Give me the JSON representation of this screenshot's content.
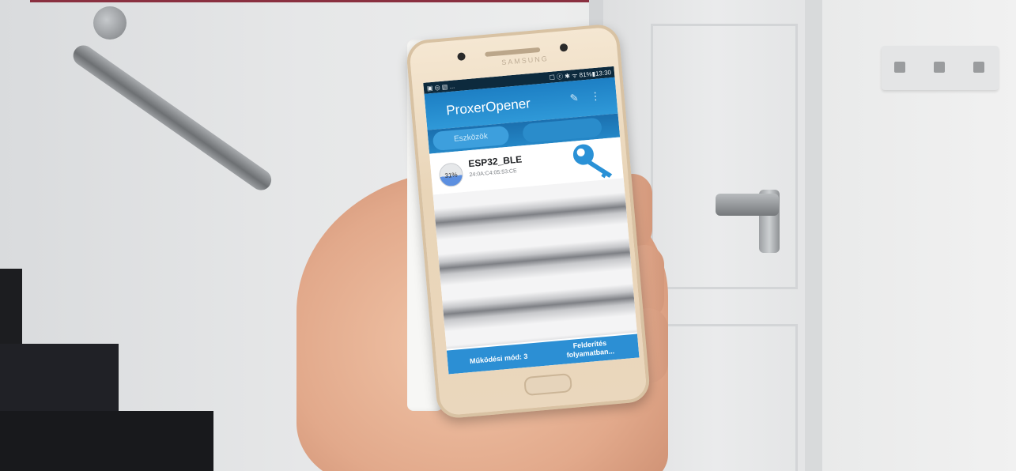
{
  "scene": {
    "phone_brand": "SAMSUNG"
  },
  "phone_screen": {
    "statusbar": {
      "left_icons": "▣ ◎ ▤ ...",
      "right": "☐ ⓒ ✱ ᯤ 81%▮13:30"
    },
    "appbar": {
      "title": "ProxerOpener",
      "tool_icon": "✎",
      "more_icon": "⋮"
    },
    "tabs": {
      "active_label": "Eszközök",
      "second_label": ""
    },
    "device": {
      "battery_label": "31%",
      "name": "ESP32_BLE",
      "mac": "24:0A:C4:05:53:CE",
      "icon": "key-icon"
    },
    "footer": {
      "mode_label": "Működési mód: 3",
      "scan_line1": "Felderítés",
      "scan_line2": "folyamatban..."
    }
  },
  "colors": {
    "appbar": "#1d7fc4",
    "footer": "#2c8fd4",
    "key_icon": "#2a91d6"
  }
}
